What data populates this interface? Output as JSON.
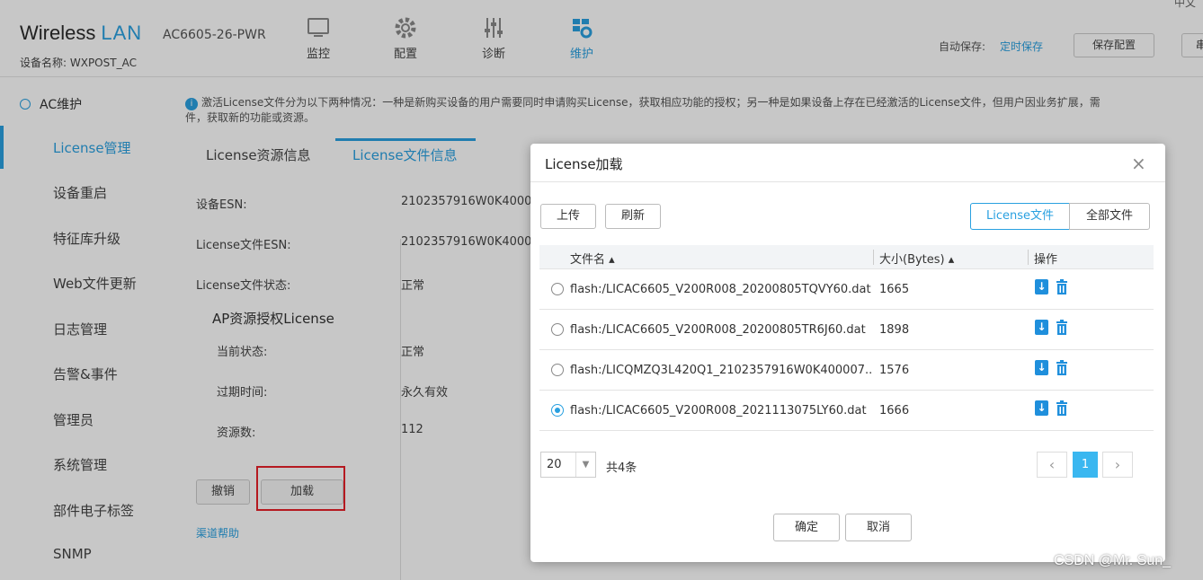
{
  "header": {
    "logo_wireless": "Wireless",
    "logo_lan": "LAN",
    "model": "AC6605-26-PWR",
    "device_name": "设备名称:  WXPOST_AC",
    "nav": [
      {
        "label": "监控",
        "icon": "monitor-icon"
      },
      {
        "label": "配置",
        "icon": "gear-icon"
      },
      {
        "label": "诊断",
        "icon": "diagnose-icon"
      },
      {
        "label": "维护",
        "icon": "maintenance-icon"
      }
    ],
    "autosave_label": "自动保存:",
    "autosave_value": "定时保存",
    "save_config": "保存配置",
    "right_edge_btn": "串",
    "top_corner_text": "中文"
  },
  "sidebar": {
    "head": "AC维护",
    "items": [
      {
        "label": "License管理",
        "active": true
      },
      {
        "label": "设备重启",
        "active": false
      },
      {
        "label": "特征库升级",
        "active": false
      },
      {
        "label": "Web文件更新",
        "active": false
      },
      {
        "label": "日志管理",
        "active": false
      },
      {
        "label": "告警&事件",
        "active": false
      },
      {
        "label": "管理员",
        "active": false
      },
      {
        "label": "系统管理",
        "active": false
      },
      {
        "label": "部件电子标签",
        "active": false
      },
      {
        "label": "SNMP",
        "active": false
      }
    ]
  },
  "main": {
    "info": "激活License文件分为以下两种情况：一种是新购买设备的用户需要同时申请购买License，获取相应功能的授权；另一种是如果设备上存在已经激活的License文件，但用户因业务扩展，需",
    "info_cont": "件，获取新的功能或资源。",
    "tabs": [
      "License资源信息",
      "License文件信息"
    ],
    "fields": [
      {
        "label": "设备ESN:",
        "value": "2102357916W0K4000"
      },
      {
        "label": "License文件ESN:",
        "value": "2102357916W0K4000"
      },
      {
        "label": "License文件状态:",
        "value": "正常"
      }
    ],
    "section_title": "AP资源授权License",
    "section_fields": [
      {
        "label": "当前状态:",
        "value": "正常"
      },
      {
        "label": "过期时间:",
        "value": "永久有效"
      },
      {
        "label": "资源数:",
        "value": "112"
      }
    ],
    "revoke_btn": "撤销",
    "load_btn": "加载",
    "link": "渠道帮助"
  },
  "dialog": {
    "title": "License加载",
    "close": "×",
    "upload": "上传",
    "refresh": "刷新",
    "filter_license": "License文件",
    "filter_all": "全部文件",
    "col_name": "文件名 ▴",
    "col_size": "大小(Bytes) ▴",
    "col_op": "操作",
    "rows": [
      {
        "name": "flash:/LICAC6605_V200R008_20200805TQVY60.dat",
        "size": "1665",
        "selected": false
      },
      {
        "name": "flash:/LICAC6605_V200R008_20200805TR6J60.dat",
        "size": "1898",
        "selected": false
      },
      {
        "name": "flash:/LICQMZQ3L420Q1_2102357916W0K400007...",
        "size": "1576",
        "selected": false
      },
      {
        "name": "flash:/LICAC6605_V200R008_2021113075LY60.dat",
        "size": "1666",
        "selected": true
      }
    ],
    "page_size": "20",
    "total": "共4条",
    "prev": "‹",
    "page": "1",
    "next": "›",
    "ok": "确定",
    "cancel": "取消"
  },
  "watermark": "CSDN @Mr. Sun_"
}
